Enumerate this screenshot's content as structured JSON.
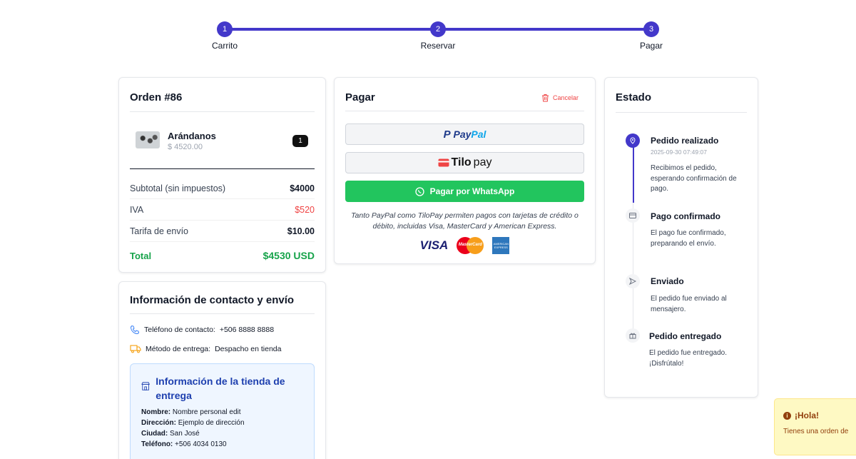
{
  "stepper": {
    "steps": [
      {
        "number": "1",
        "label": "Carrito"
      },
      {
        "number": "2",
        "label": "Reservar"
      },
      {
        "number": "3",
        "label": "Pagar"
      }
    ]
  },
  "order": {
    "title": "Orden #86",
    "item": {
      "name": "Arándanos",
      "price": "$ 4520.00",
      "quantity": "1"
    },
    "subtotal_label": "Subtotal (sin impuestos)",
    "subtotal_value": "$4000",
    "iva_label": "IVA",
    "iva_value": "$520",
    "shipping_label": "Tarifa de envío",
    "shipping_value": "$10.00",
    "total_label": "Total",
    "total_value": "$4530 USD"
  },
  "pay": {
    "title": "Pagar",
    "cancel_label": "Cancelar",
    "paypal_label_a": "Pay",
    "paypal_label_b": "Pal",
    "tilopay_label_a": "Tilo",
    "tilopay_label_b": "pay",
    "whatsapp_label": "Pagar por WhatsApp",
    "note": "Tanto PayPal como TiloPay permiten pagos con tarjetas de crédito o débito, incluidas Visa, MasterCard y American Express.",
    "visa": "VISA",
    "mastercard": "MasterCard",
    "amex": "AMERICAN EXPRESS"
  },
  "estado": {
    "title": "Estado",
    "steps": [
      {
        "title": "Pedido realizado",
        "date": "2025-09-30 07:49:07",
        "desc": "Recibimos el pedido, esperando confirmación de pago."
      },
      {
        "title": "Pago confirmado",
        "desc": "El pago fue confirmado, preparando el envío."
      },
      {
        "title": "Enviado",
        "desc": "El pedido fue enviado al mensajero."
      },
      {
        "title": "Pedido entregado",
        "desc": "El pedido fue entregado. ¡Disfrútalo!"
      }
    ]
  },
  "contact": {
    "title": "Información de contacto y envío",
    "phone_label": "Teléfono de contacto:",
    "phone_value": "+506 8888 8888",
    "delivery_label": "Método de entrega:",
    "delivery_value": "Despacho en tienda",
    "store": {
      "title": "Información de la tienda de entrega",
      "name_label": "Nombre:",
      "name_value": "Nombre personal edit",
      "address_label": "Dirección:",
      "address_value": "Ejemplo de dirección",
      "city_label": "Ciudad:",
      "city_value": "San José",
      "phone_label": "Teléfono:",
      "phone_value": "+506 4034 0130"
    }
  },
  "toast": {
    "title": "¡Hola!",
    "message": "Tienes una orden de"
  },
  "colors": {
    "accent": "#4338ca",
    "success": "#16a34a",
    "danger": "#ef4444",
    "whatsapp": "#22c55e"
  }
}
